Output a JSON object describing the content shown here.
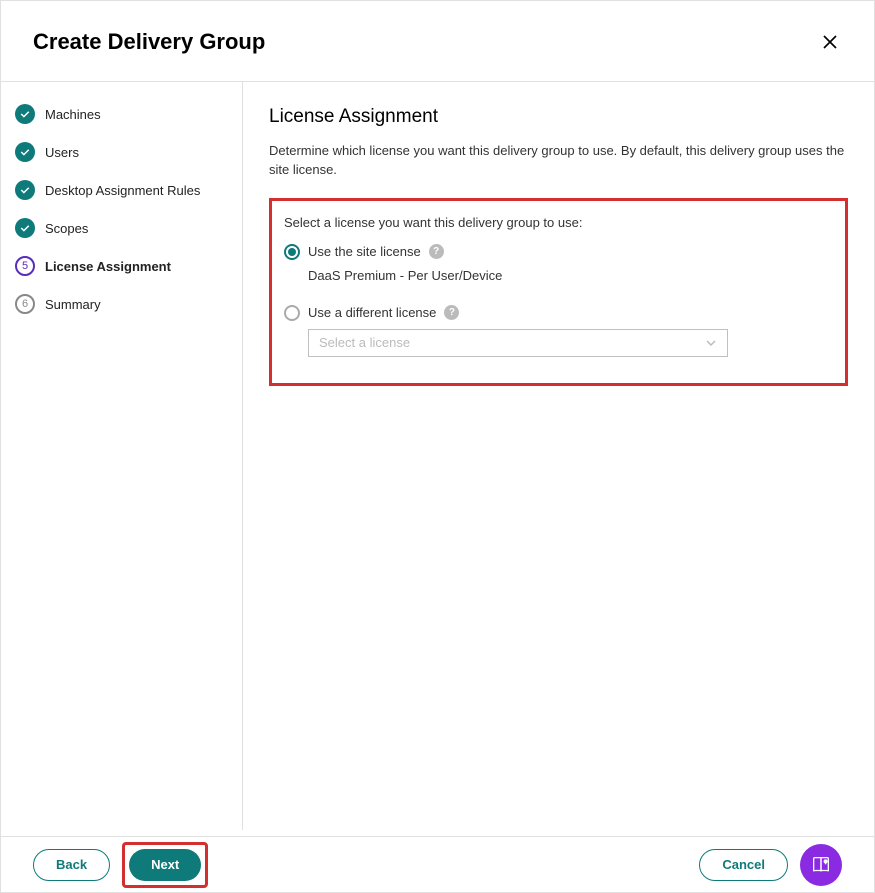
{
  "header": {
    "title": "Create Delivery Group"
  },
  "steps": [
    {
      "label": "Machines",
      "state": "done"
    },
    {
      "label": "Users",
      "state": "done"
    },
    {
      "label": "Desktop Assignment Rules",
      "state": "done"
    },
    {
      "label": "Scopes",
      "state": "done"
    },
    {
      "number": "5",
      "label": "License Assignment",
      "state": "current"
    },
    {
      "number": "6",
      "label": "Summary",
      "state": "pending"
    }
  ],
  "main": {
    "heading": "License Assignment",
    "description": "Determine which license you want this delivery group to use. By default, this delivery group uses the site license.",
    "prompt": "Select a license you want this delivery group to use:",
    "option1": {
      "label": "Use the site license",
      "detail": "DaaS Premium - Per User/Device"
    },
    "option2": {
      "label": "Use a different license",
      "placeholder": "Select a license"
    }
  },
  "footer": {
    "back": "Back",
    "next": "Next",
    "cancel": "Cancel"
  }
}
